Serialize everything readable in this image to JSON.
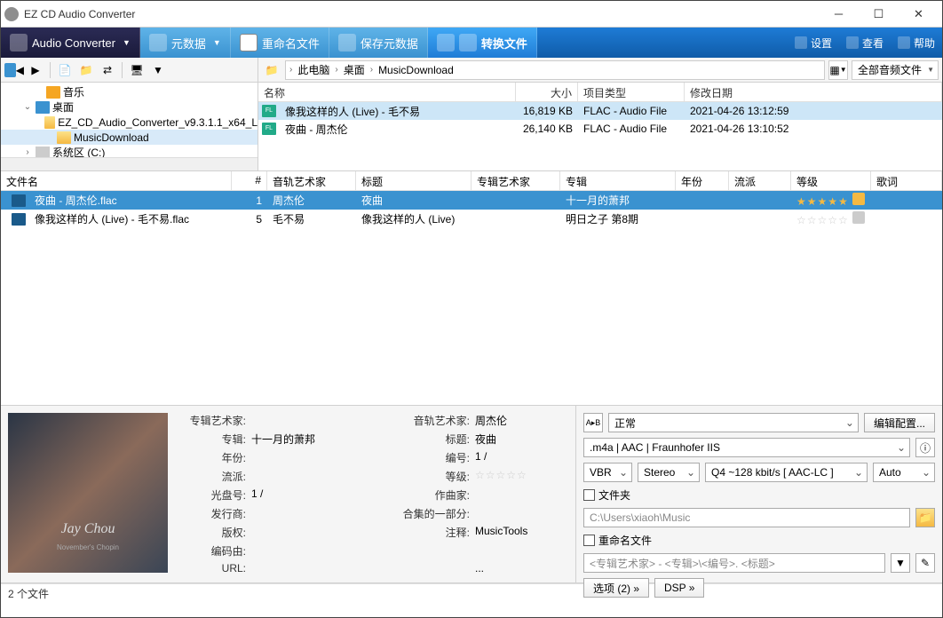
{
  "window": {
    "title": "EZ CD Audio Converter"
  },
  "toolbar": {
    "audio_converter": "Audio Converter",
    "metadata": "元数据",
    "rename_files": "重命名文件",
    "save_metadata": "保存元数据",
    "convert_files": "转换文件",
    "settings": "设置",
    "view": "查看",
    "help": "帮助"
  },
  "breadcrumb": {
    "p1": "此电脑",
    "p2": "桌面",
    "p3": "MusicDownload"
  },
  "filter": "全部音频文件",
  "tree": {
    "music": "音乐",
    "desktop": "桌面",
    "ezcd": "EZ_CD_Audio_Converter_v9.3.1.1_x64_L",
    "musicdownload": "MusicDownload",
    "system": "系统区 (C:)"
  },
  "file_cols": {
    "name": "名称",
    "size": "大小",
    "type": "项目类型",
    "date": "修改日期"
  },
  "files": [
    {
      "name": "像我这样的人 (Live) - 毛不易",
      "size": "16,819 KB",
      "type": "FLAC - Audio File",
      "date": "2021-04-26 13:12:59"
    },
    {
      "name": "夜曲 - 周杰伦",
      "size": "26,140 KB",
      "type": "FLAC - Audio File",
      "date": "2021-04-26 13:10:52"
    }
  ],
  "track_cols": {
    "filename": "文件名",
    "num": "#",
    "artist": "音轨艺术家",
    "title": "标题",
    "album_artist": "专辑艺术家",
    "album": "专辑",
    "year": "年份",
    "genre": "流派",
    "rating": "等级",
    "lyrics": "歌词"
  },
  "tracks": [
    {
      "filename": "夜曲 - 周杰伦.flac",
      "num": "1",
      "artist": "周杰伦",
      "title": "夜曲",
      "album_artist": "",
      "album": "十一月的萧邦",
      "year": "",
      "genre": "",
      "rating": 5
    },
    {
      "filename": "像我这样的人 (Live) - 毛不易.flac",
      "num": "5",
      "artist": "毛不易",
      "title": "像我这样的人 (Live)",
      "album_artist": "",
      "album": "明日之子 第8期",
      "year": "",
      "genre": "",
      "rating": 0
    }
  ],
  "meta": {
    "labels": {
      "album_artist": "专辑艺术家:",
      "album": "专辑:",
      "year": "年份:",
      "genre": "流派:",
      "disc": "光盘号:",
      "publisher": "发行商:",
      "copyright": "版权:",
      "encoded_by": "编码由:",
      "url": "URL:",
      "track_artist": "音轨艺术家:",
      "title": "标题:",
      "track_no": "编号:",
      "rating": "等级:",
      "composer": "作曲家:",
      "compilation": "合集的一部分:",
      "comment": "注释:"
    },
    "vals": {
      "album_artist": "",
      "album": "十一月的萧邦",
      "year": "",
      "genre": "",
      "disc": "1  /",
      "publisher": "",
      "copyright": "",
      "encoded_by": "",
      "url": "",
      "track_artist": "周杰伦",
      "title": "夜曲",
      "track_no": "1  /",
      "rating_stars": "☆☆☆☆☆",
      "composer": "",
      "compilation": "",
      "comment": "MusicTools",
      "ellipsis": "..."
    },
    "art_name": "Jay Chou",
    "art_sub": "November's Chopin"
  },
  "output": {
    "mode": "正常",
    "edit_config": "编辑配置...",
    "format": ".m4a  |  AAC  |  Fraunhofer IIS",
    "vbr": "VBR",
    "stereo": "Stereo",
    "quality": "Q4 ~128 kbit/s [ AAC-LC ]",
    "auto": "Auto",
    "folder_chk": "文件夹",
    "folder_path": "C:\\Users\\xiaoh\\Music",
    "rename_chk": "重命名文件",
    "rename_pattern": "<专辑艺术家> - <专辑>\\<编号>. <标题>",
    "options": "选项 (2) »",
    "dsp": "DSP »"
  },
  "status": {
    "count": "2 个文件"
  }
}
